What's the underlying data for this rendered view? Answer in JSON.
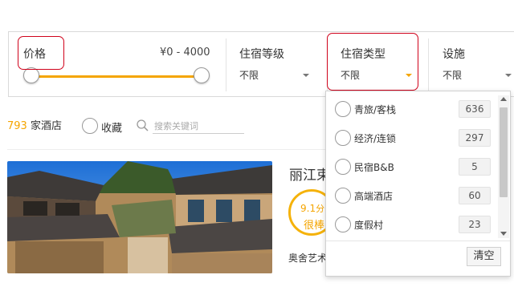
{
  "filters": {
    "price": {
      "label": "价格",
      "range": "¥0 - 4000",
      "min_fraction": 0.0,
      "max_fraction": 1.0
    },
    "star_level": {
      "title": "住宿等级",
      "value": "不限"
    },
    "lodging_type": {
      "title": "住宿类型",
      "value": "不限"
    },
    "facilities": {
      "title": "设施",
      "value": "不限"
    }
  },
  "summary": {
    "count": "793",
    "count_suffix": "家酒店",
    "favorites_label": "收藏",
    "search_placeholder": "搜索关键词"
  },
  "hotel": {
    "name": "丽江束",
    "score": "9.1",
    "score_unit": "分",
    "score_word": "很棒",
    "subtitle": "奥舍艺术"
  },
  "dropdown": {
    "items": [
      {
        "label": "青旅/客栈",
        "count": "636"
      },
      {
        "label": "经济/连锁",
        "count": "297"
      },
      {
        "label": "民宿B&B",
        "count": "5"
      },
      {
        "label": "高端酒店",
        "count": "60"
      },
      {
        "label": "度假村",
        "count": "23"
      }
    ],
    "clear_label": "清空"
  },
  "colors": {
    "accent": "#f5a500",
    "highlight_box": "#d0021b"
  }
}
